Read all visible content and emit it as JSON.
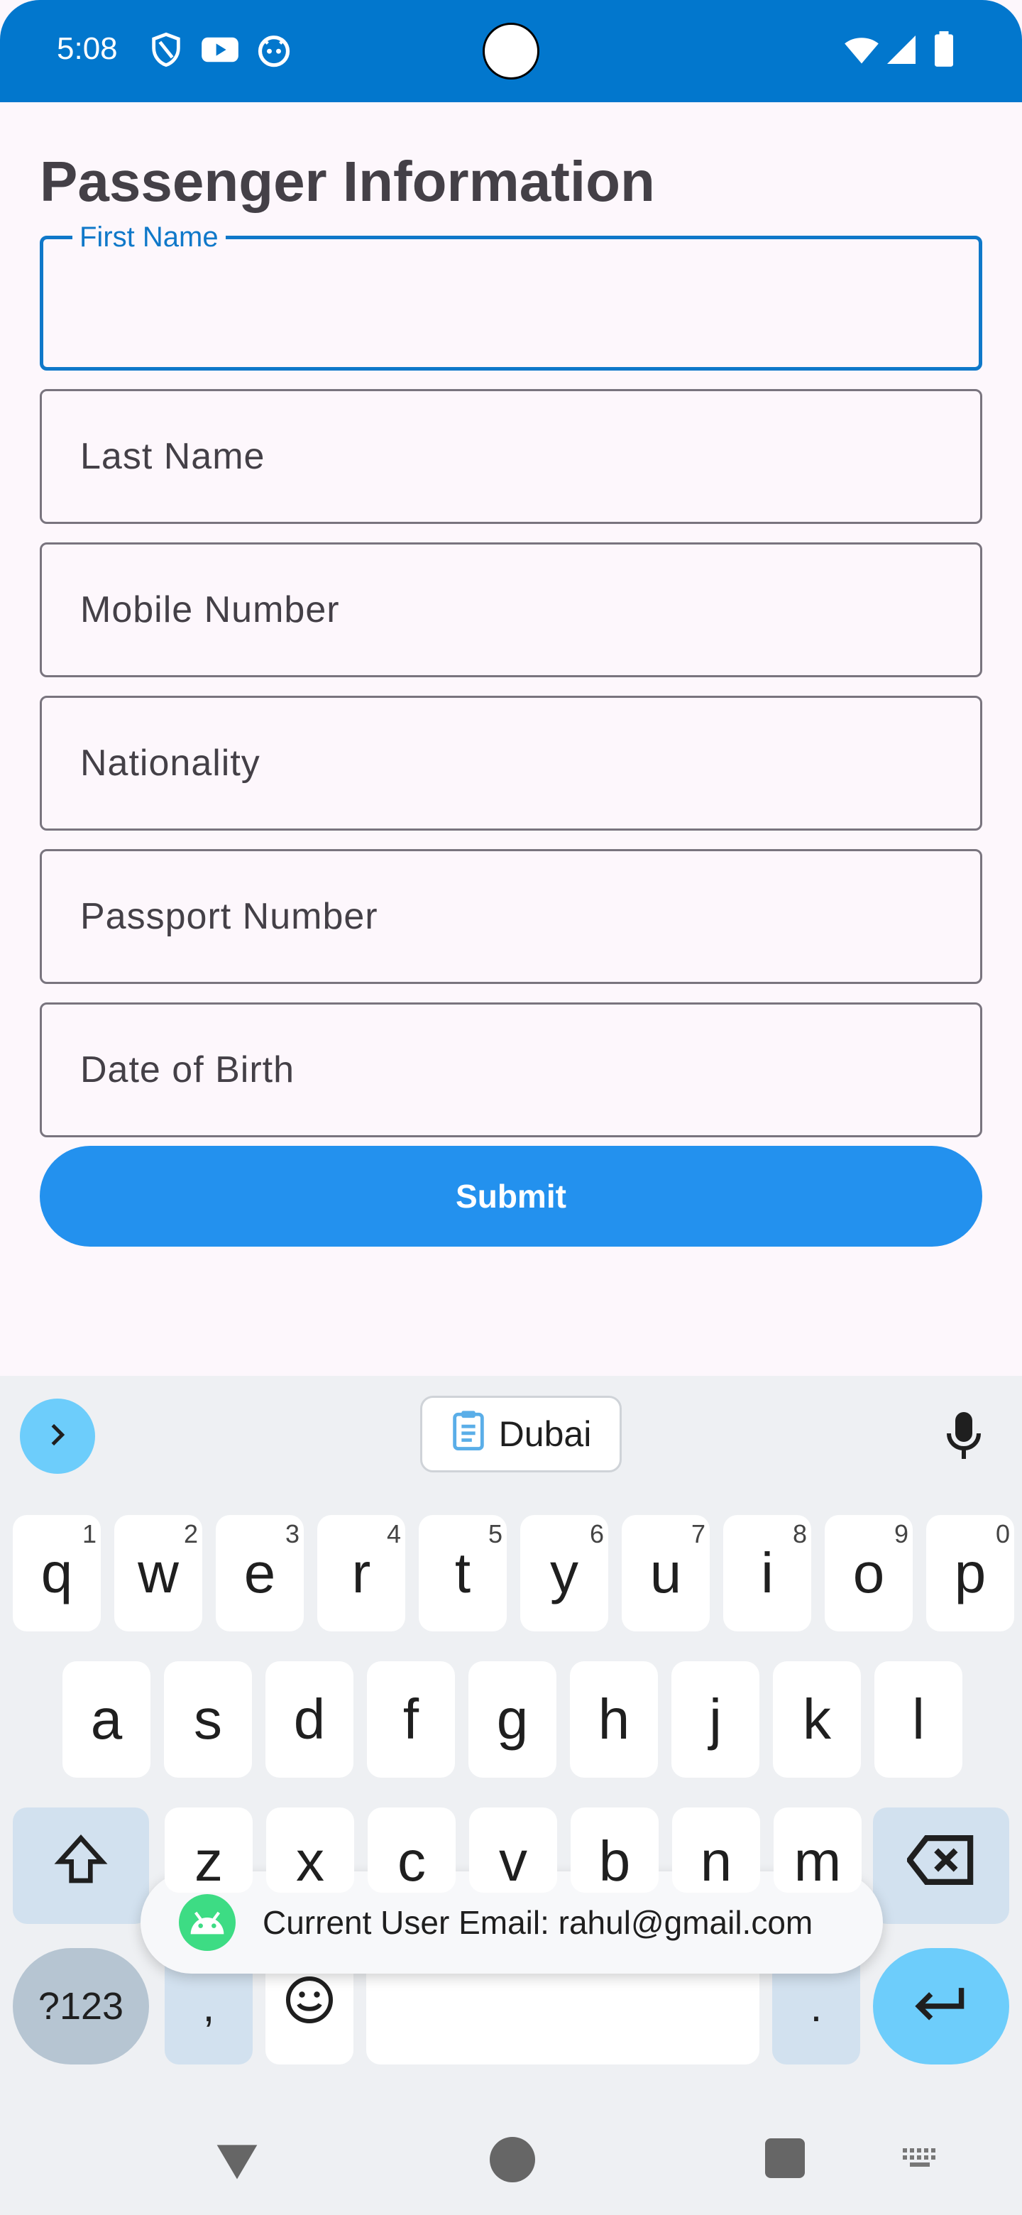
{
  "status_bar": {
    "time": "5:08"
  },
  "page": {
    "title": "Passenger Information"
  },
  "form": {
    "first_name_label": "First Name",
    "last_name_placeholder": "Last Name",
    "mobile_placeholder": "Mobile Number",
    "nationality_placeholder": "Nationality",
    "passport_placeholder": "Passport Number",
    "dob_placeholder": "Date of Birth",
    "submit_label": "Submit"
  },
  "keyboard": {
    "suggestion_chip": "Dubai",
    "row1": [
      {
        "key": "q",
        "hint": "1"
      },
      {
        "key": "w",
        "hint": "2"
      },
      {
        "key": "e",
        "hint": "3"
      },
      {
        "key": "r",
        "hint": "4"
      },
      {
        "key": "t",
        "hint": "5"
      },
      {
        "key": "y",
        "hint": "6"
      },
      {
        "key": "u",
        "hint": "7"
      },
      {
        "key": "i",
        "hint": "8"
      },
      {
        "key": "o",
        "hint": "9"
      },
      {
        "key": "p",
        "hint": "0"
      }
    ],
    "row2": [
      "a",
      "s",
      "d",
      "f",
      "g",
      "h",
      "j",
      "k",
      "l"
    ],
    "row3": [
      "z",
      "x",
      "c",
      "v",
      "b",
      "n",
      "m"
    ],
    "symbols_key": "?123",
    "comma_key": ",",
    "period_key": "."
  },
  "toast": {
    "message": "Current User Email: rahul@gmail.com"
  },
  "colors": {
    "status_bar": "#0277cd",
    "accent": "#0f78c9",
    "submit": "#2391ee",
    "keyboard_accent": "#6dcdfb"
  }
}
